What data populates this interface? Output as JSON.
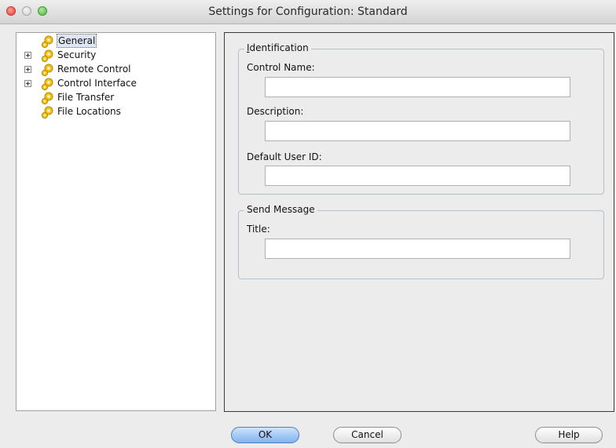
{
  "window": {
    "title": "Settings for Configuration: Standard"
  },
  "tree": {
    "items": [
      {
        "label": "General",
        "expandable": false,
        "selected": true,
        "icon": "gear-icon"
      },
      {
        "label": "Security",
        "expandable": true,
        "selected": false,
        "icon": "gear-icon"
      },
      {
        "label": "Remote Control",
        "expandable": true,
        "selected": false,
        "icon": "gear-icon"
      },
      {
        "label": "Control Interface",
        "expandable": true,
        "selected": false,
        "icon": "gear-icon"
      },
      {
        "label": "File Transfer",
        "expandable": false,
        "selected": false,
        "icon": "gear-icon"
      },
      {
        "label": "File Locations",
        "expandable": false,
        "selected": false,
        "icon": "gear-icon"
      }
    ]
  },
  "identification": {
    "legend_mnemonic": "I",
    "legend_rest": "dentification",
    "control_name_label": "Control Name:",
    "control_name_value": "",
    "description_label": "Description:",
    "description_value": "",
    "default_user_id_label": "Default User ID:",
    "default_user_id_value": ""
  },
  "send_message": {
    "legend": "Send Message",
    "title_label": "Title:",
    "title_value": ""
  },
  "buttons": {
    "ok": "OK",
    "cancel": "Cancel",
    "help": "Help"
  },
  "colors": {
    "default_button": "#7fb3ef",
    "close_button": "#e0443e",
    "zoom_button": "#54b040"
  }
}
